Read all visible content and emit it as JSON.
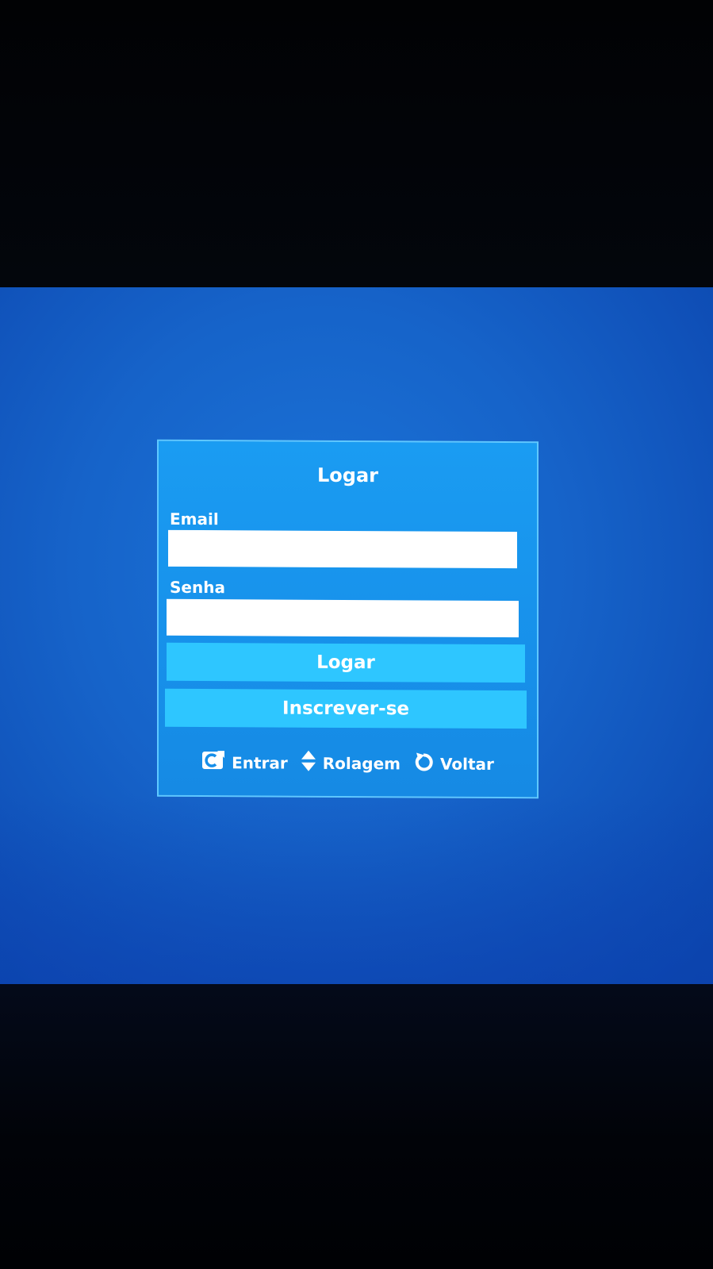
{
  "dialog": {
    "title": "Logar",
    "email_label": "Email",
    "email_value": "",
    "password_label": "Senha",
    "password_value": "",
    "login_button": "Logar",
    "signup_button": "Inscrever-se"
  },
  "hints": [
    {
      "icon": "enter-icon",
      "label": "Entrar"
    },
    {
      "icon": "scroll-updown-icon",
      "label": "Rolagem"
    },
    {
      "icon": "back-arrow-icon",
      "label": "Voltar"
    }
  ],
  "colors": {
    "screen_background": "#1663c9",
    "dialog_background": "#1790ea",
    "dialog_border": "#5fc8ff",
    "button_background": "#2ec6ff",
    "text": "#ffffff"
  }
}
